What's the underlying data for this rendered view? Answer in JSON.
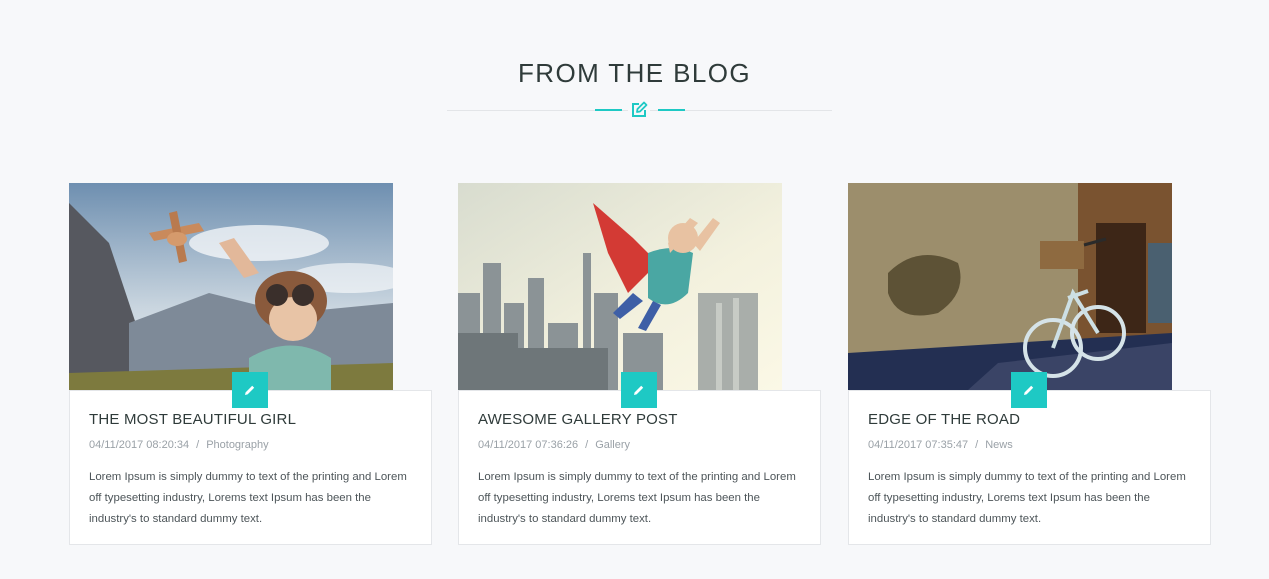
{
  "section": {
    "title": "FROM THE BLOG",
    "divider_icon": "edit-icon",
    "accent_color": "#1ec9c4"
  },
  "posts": [
    {
      "title": "THE MOST BEAUTIFUL GIRL",
      "date": "04/11/2017 08:20:34",
      "separator": "/",
      "category": "Photography",
      "excerpt": "Lorem Ipsum is simply dummy to text of the printing and Lorem off typesetting industry, Lorems text Ipsum has been the industry's to standard dummy text.",
      "badge_icon": "pencil-icon"
    },
    {
      "title": "AWESOME GALLERY POST",
      "date": "04/11/2017 07:36:26",
      "separator": "/",
      "category": "Gallery",
      "excerpt": "Lorem Ipsum is simply dummy to text of the printing and Lorem off typesetting industry, Lorems text Ipsum has been the industry's to standard dummy text.",
      "badge_icon": "pencil-icon"
    },
    {
      "title": "EDGE OF THE ROAD",
      "date": "04/11/2017 07:35:47",
      "separator": "/",
      "category": "News",
      "excerpt": "Lorem Ipsum is simply dummy to text of the printing and Lorem off typesetting industry, Lorems text Ipsum has been the industry's to standard dummy text.",
      "badge_icon": "pencil-icon"
    }
  ]
}
